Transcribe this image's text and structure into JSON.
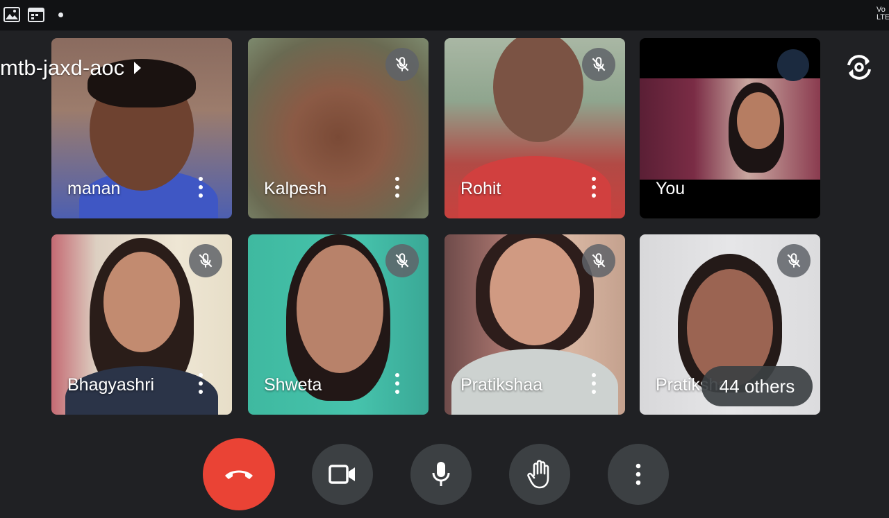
{
  "status_bar": {
    "icons": [
      "gallery-icon",
      "calendar-icon",
      "notification-dot"
    ],
    "network_line1": "Vo",
    "network_line2": "LTE"
  },
  "meeting": {
    "code": "mtb-jaxd-aoc"
  },
  "participants": [
    {
      "name": "manan",
      "muted": false,
      "menu_icon": "more-vert-icon"
    },
    {
      "name": "Kalpesh",
      "muted": true,
      "menu_icon": "more-vert-icon"
    },
    {
      "name": "Rohit",
      "muted": true,
      "menu_icon": "more-vert-icon"
    },
    {
      "name": "You",
      "muted": false
    },
    {
      "name": "Bhagyashri",
      "muted": true,
      "menu_icon": "more-vert-icon"
    },
    {
      "name": "Shweta",
      "muted": true,
      "menu_icon": "more-vert-icon"
    },
    {
      "name": "Pratikshaa",
      "muted": true,
      "menu_icon": "more-vert-icon"
    },
    {
      "name": "Pratiksha",
      "muted": true
    }
  ],
  "others_chip": {
    "label": "44 others"
  },
  "controls": {
    "buttons": [
      "end-call",
      "camera",
      "microphone",
      "raise-hand",
      "more-options"
    ],
    "end_call_color": "#ea4335",
    "button_color": "#3c4043"
  },
  "colors": {
    "background": "#202124",
    "status_bar": "#111214",
    "mute_badge": "#5f6368"
  }
}
